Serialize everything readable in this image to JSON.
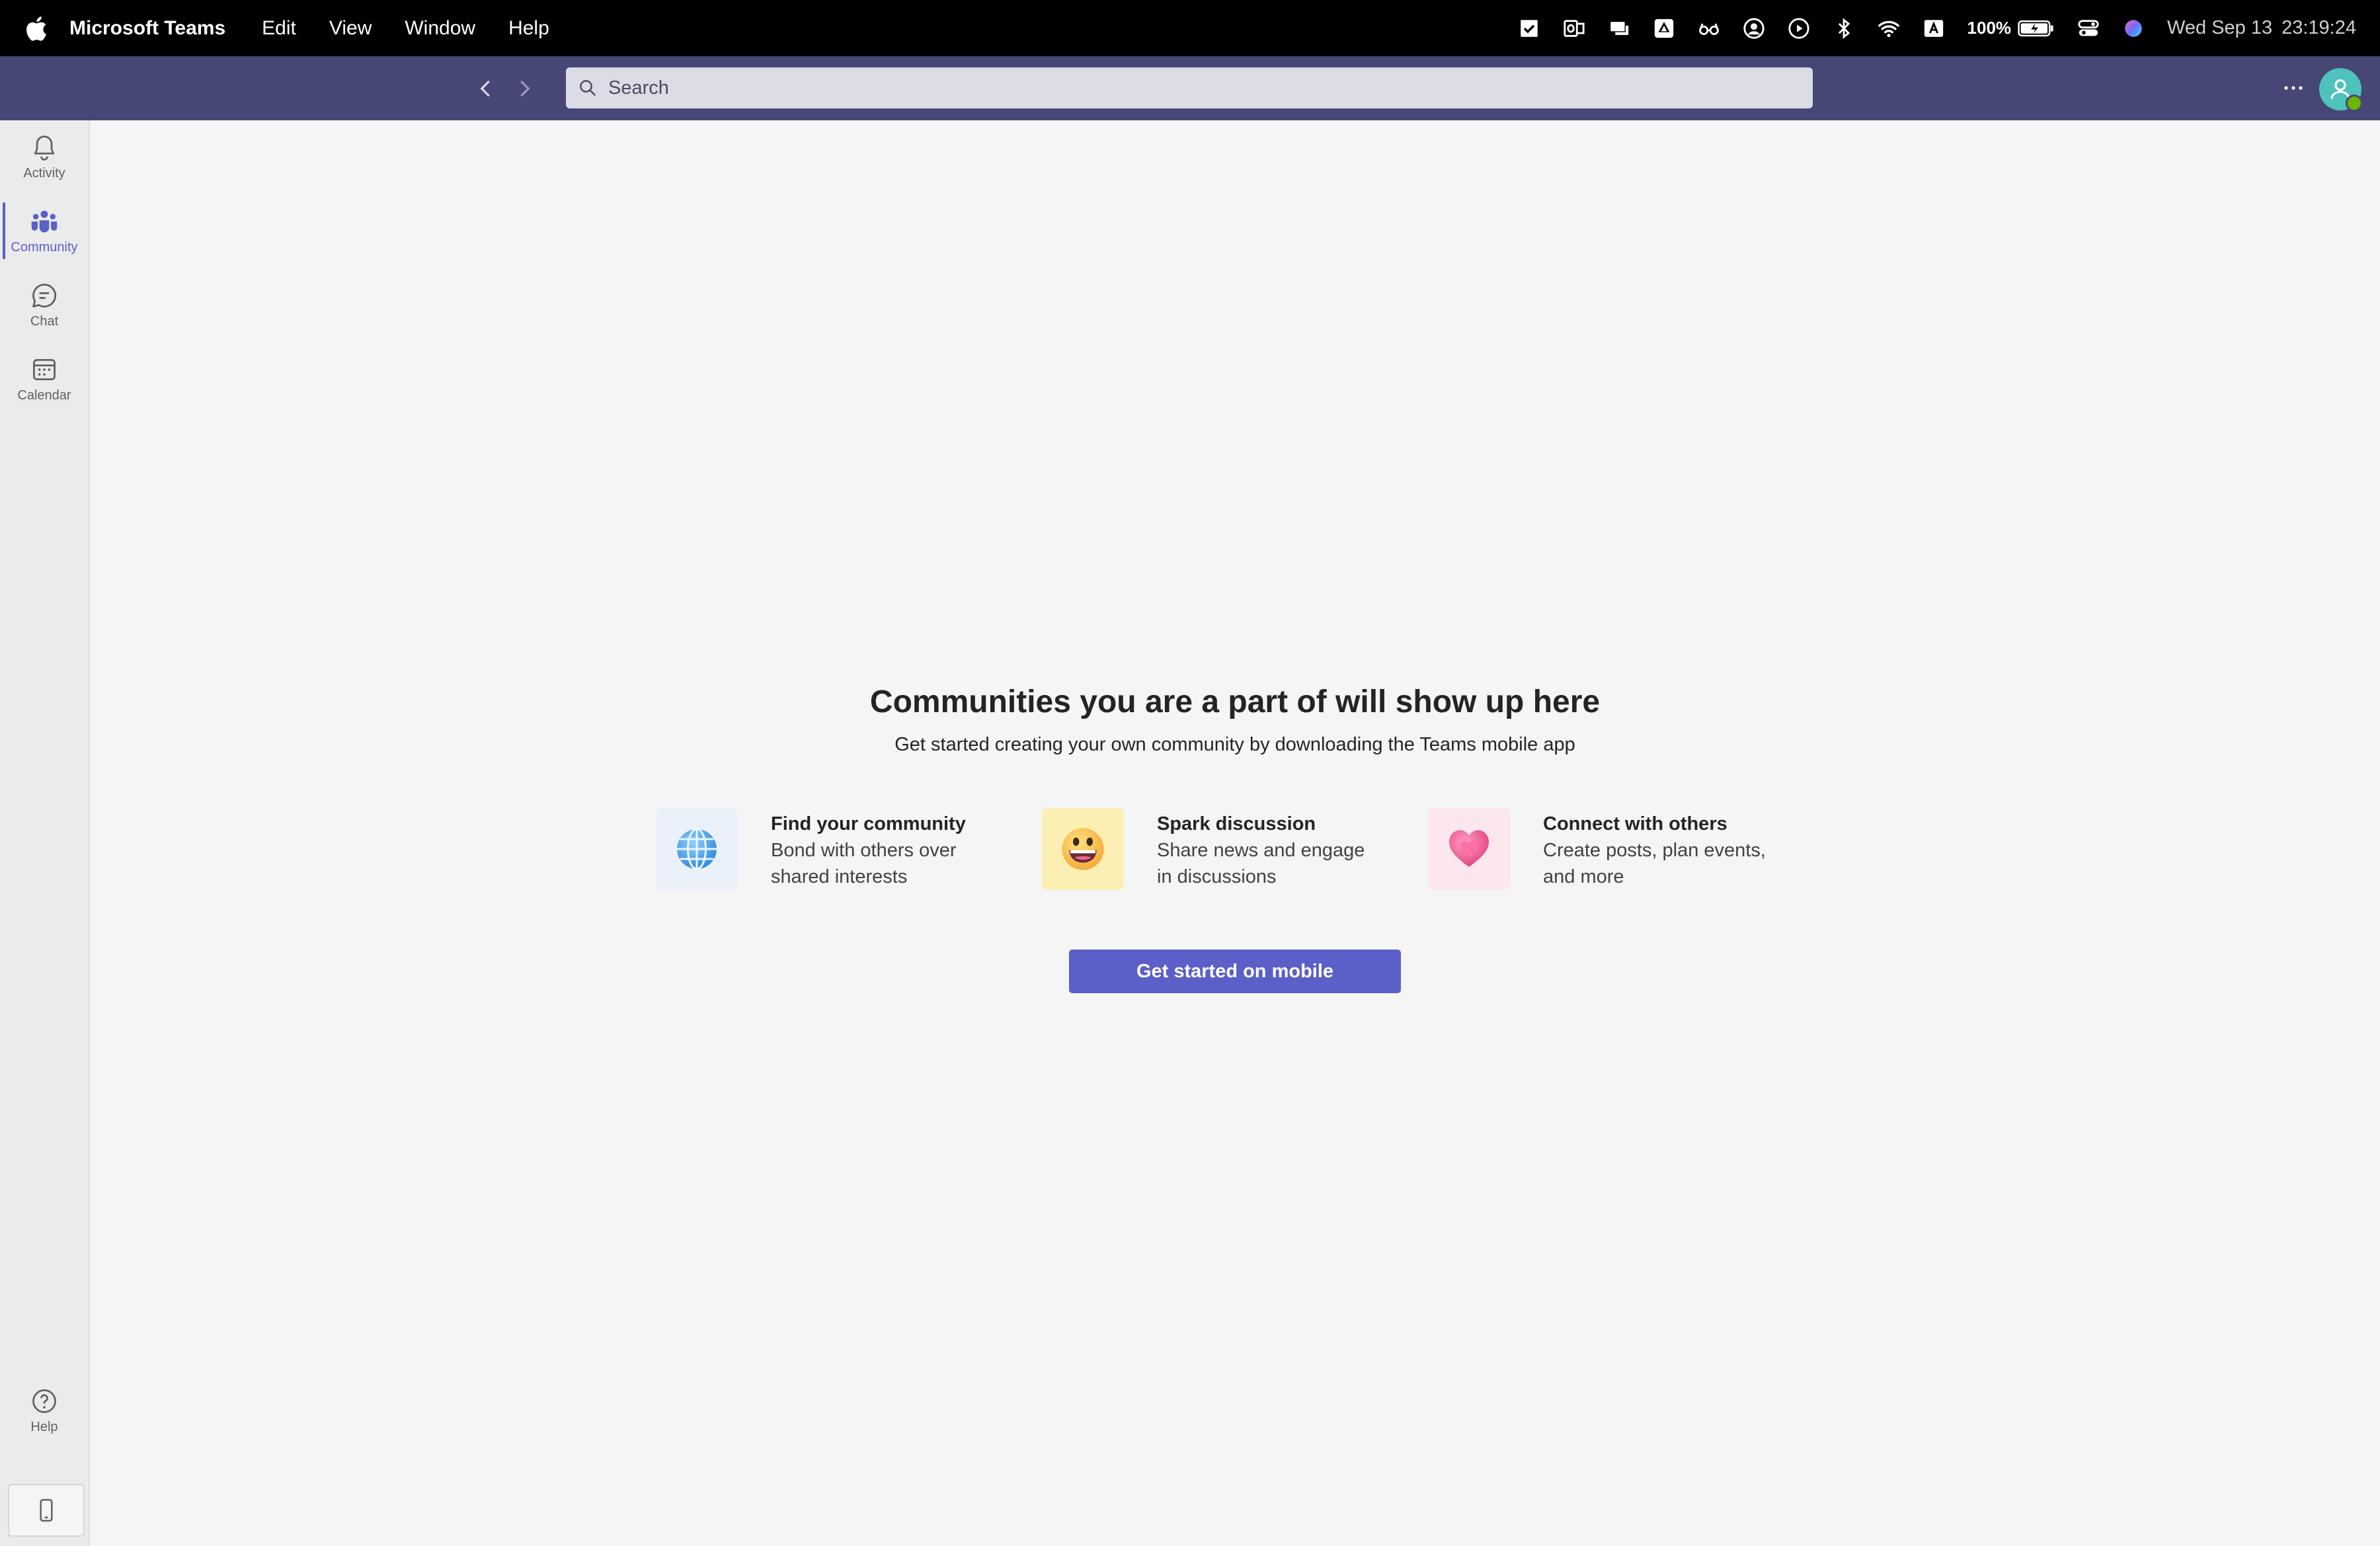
{
  "menubar": {
    "app_name": "Microsoft Teams",
    "menus": [
      "Edit",
      "View",
      "Window",
      "Help"
    ],
    "battery": "100%",
    "clock_date": "Wed Sep 13",
    "clock_time": "23:19:24",
    "status_icons": [
      "checkmark-app-icon",
      "outlook-icon",
      "presenter-icon",
      "drive-icon",
      "glasses-icon",
      "user-circle-icon",
      "play-circle-icon",
      "bluetooth-icon",
      "wifi-icon",
      "input-source-icon",
      "battery-icon",
      "control-center-icon",
      "siri-icon"
    ]
  },
  "titlebar": {
    "search_placeholder": "Search"
  },
  "rail": {
    "items": [
      {
        "label": "Activity",
        "icon": "bell-icon"
      },
      {
        "label": "Community",
        "icon": "community-icon"
      },
      {
        "label": "Chat",
        "icon": "chat-icon"
      },
      {
        "label": "Calendar",
        "icon": "calendar-icon"
      }
    ],
    "help_label": "Help",
    "active": "Community"
  },
  "main": {
    "headline": "Communities you are a part of will show up here",
    "subhead": "Get started creating your own community by downloading the Teams mobile app",
    "features": [
      {
        "title": "Find your community",
        "desc": "Bond with others over shared interests",
        "icon": "globe-icon"
      },
      {
        "title": "Spark discussion",
        "desc": "Share news and engage in discussions",
        "icon": "grinning-face-icon"
      },
      {
        "title": "Connect with others",
        "desc": "Create posts, plan events, and more",
        "icon": "heart-icon"
      }
    ],
    "cta_label": "Get started on mobile"
  },
  "colors": {
    "titlebar": "#464775",
    "accent": "#5b5fc7",
    "avatar": "#4ec2bd"
  }
}
